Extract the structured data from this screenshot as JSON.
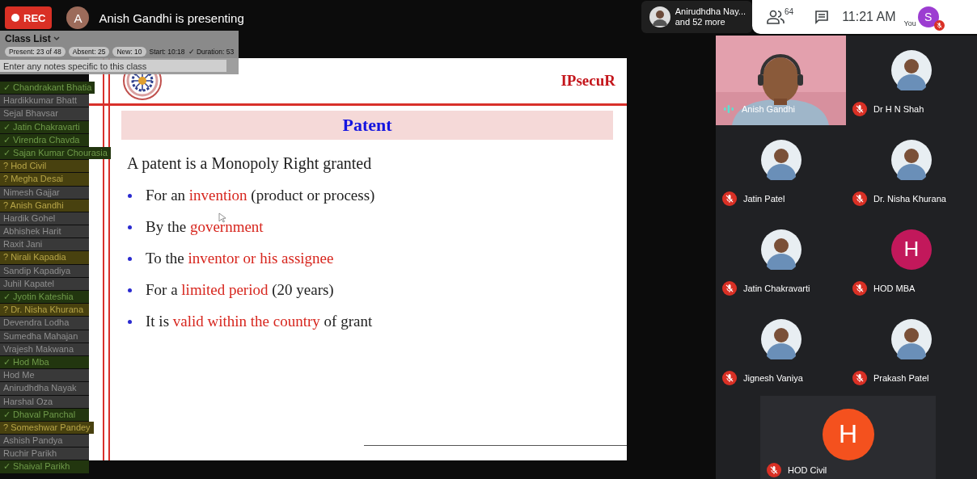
{
  "top_bar": {
    "recording": "REC",
    "presenter_initial": "A",
    "presenter_text": "Anish Gandhi is presenting",
    "others_name": "Anirudhdha Nay...",
    "others_more": "and 52 more",
    "people_count": "64",
    "time": "11:21 AM",
    "you_label": "You",
    "you_initial": "S",
    "you_muted": true
  },
  "class_list": {
    "title": "Class List",
    "chips": [
      "Present: 23 of 48",
      "Absent: 25",
      "New: 10"
    ],
    "start": "Start: 10:18",
    "duration": "✓ Duration: 53",
    "notes_placeholder": "Enter any notes specific to this class",
    "rows": [
      {
        "label": "✓ Chandrakant Bhatia",
        "kind": "present"
      },
      {
        "label": "Hardikkumar Bhatt",
        "kind": "none"
      },
      {
        "label": "Sejal Bhavsar",
        "kind": "none"
      },
      {
        "label": "✓ Jatin Chakravarti",
        "kind": "present"
      },
      {
        "label": "✓ Virendra Chavda",
        "kind": "present"
      },
      {
        "label": "✓ Sajan Kumar Chourasia",
        "kind": "present"
      },
      {
        "label": "? Hod Civil",
        "kind": "maybe"
      },
      {
        "label": "? Megha Desai",
        "kind": "maybe"
      },
      {
        "label": "Nimesh Gajjar",
        "kind": "none"
      },
      {
        "label": "? Anish Gandhi",
        "kind": "maybe"
      },
      {
        "label": "Hardik Gohel",
        "kind": "none"
      },
      {
        "label": "Abhishek Harit",
        "kind": "none"
      },
      {
        "label": "Raxit Jani",
        "kind": "none"
      },
      {
        "label": "? Nirali Kapadia",
        "kind": "maybe"
      },
      {
        "label": "Sandip Kapadiya",
        "kind": "none"
      },
      {
        "label": "Juhil Kapatel",
        "kind": "none"
      },
      {
        "label": "✓ Jyotin Kateshia",
        "kind": "present"
      },
      {
        "label": "? Dr. Nisha Khurana",
        "kind": "maybe"
      },
      {
        "label": "Devendra Lodha",
        "kind": "none"
      },
      {
        "label": "Sumedha Mahajan",
        "kind": "none"
      },
      {
        "label": "Vrajesh Makwana",
        "kind": "none"
      },
      {
        "label": "✓ Hod Mba",
        "kind": "present"
      },
      {
        "label": "Hod Me",
        "kind": "none"
      },
      {
        "label": "Anirudhdha Nayak",
        "kind": "none"
      },
      {
        "label": "Harshal Oza",
        "kind": "none"
      },
      {
        "label": "✓ Dhaval Panchal",
        "kind": "present"
      },
      {
        "label": "? Someshwar Pandey",
        "kind": "maybe"
      },
      {
        "label": "Ashish Pandya",
        "kind": "none"
      },
      {
        "label": "Ruchir Parikh",
        "kind": "none"
      },
      {
        "label": "✓ Shaival Parikh",
        "kind": "present"
      }
    ]
  },
  "slide": {
    "brand": "IPsecuR",
    "title": "Patent",
    "lead": "A patent is a Monopoly Right granted",
    "bullets": [
      [
        {
          "text": "For an ",
          "highlight": false
        },
        {
          "text": "invention",
          "highlight": true
        },
        {
          "text": " (product or process)",
          "highlight": false
        }
      ],
      [
        {
          "text": "By the ",
          "highlight": false
        },
        {
          "text": "government",
          "highlight": true
        }
      ],
      [
        {
          "text": "To the ",
          "highlight": false
        },
        {
          "text": "inventor or his assignee",
          "highlight": true
        }
      ],
      [
        {
          "text": "For a ",
          "highlight": false
        },
        {
          "text": "limited period",
          "highlight": true
        },
        {
          "text": " (20 years)",
          "highlight": false
        }
      ],
      [
        {
          "text": "It is ",
          "highlight": false
        },
        {
          "text": "valid within the country",
          "highlight": true
        },
        {
          "text": " of grant",
          "highlight": false
        }
      ]
    ]
  },
  "participants": [
    {
      "name": "Anish Gandhi",
      "kind": "video",
      "muted": false
    },
    {
      "name": "Dr H N Shah",
      "muted": true
    },
    {
      "name": "Jatin Patel",
      "muted": true
    },
    {
      "name": "Dr. Nisha Khurana",
      "muted": true
    },
    {
      "name": "Jatin Chakravarti",
      "muted": true
    },
    {
      "name": "HOD MBA",
      "kind": "letter",
      "initial": "H",
      "color": "#c2185b",
      "muted": true
    },
    {
      "name": "Jignesh Vaniya",
      "muted": true
    },
    {
      "name": "Prakash Patel",
      "muted": true
    },
    {
      "name": "HOD Civil",
      "kind": "letter",
      "initial": "H",
      "color": "#f4511e",
      "muted": true
    }
  ]
}
